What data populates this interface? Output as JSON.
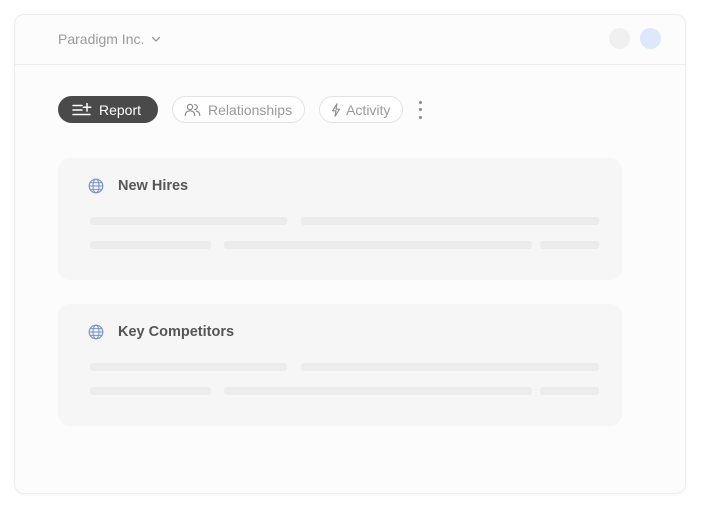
{
  "header": {
    "company_name": "Paradigm Inc.",
    "company_icon": "chevron-down-icon",
    "avatars": [
      {
        "name": "avatar-gray",
        "color": "#f0f0f0"
      },
      {
        "name": "avatar-blue",
        "color": "#dde8fb"
      }
    ]
  },
  "tabs": [
    {
      "label": "Report",
      "icon": "report-list-add-icon",
      "active": true
    },
    {
      "label": "Relationships",
      "icon": "people-icon",
      "active": false
    },
    {
      "label": "Activity",
      "icon": "lightning-icon",
      "active": false
    }
  ],
  "more_icon": "more-vertical-icon",
  "cards": [
    {
      "title": "New Hires",
      "icon": "globe-icon",
      "loading": true
    },
    {
      "title": "Key Competitors",
      "icon": "globe-icon",
      "loading": true
    }
  ],
  "colors": {
    "active_tab_bg": "#4a4a4a",
    "globe": "#7b95c9",
    "skeleton": "#ececec"
  }
}
